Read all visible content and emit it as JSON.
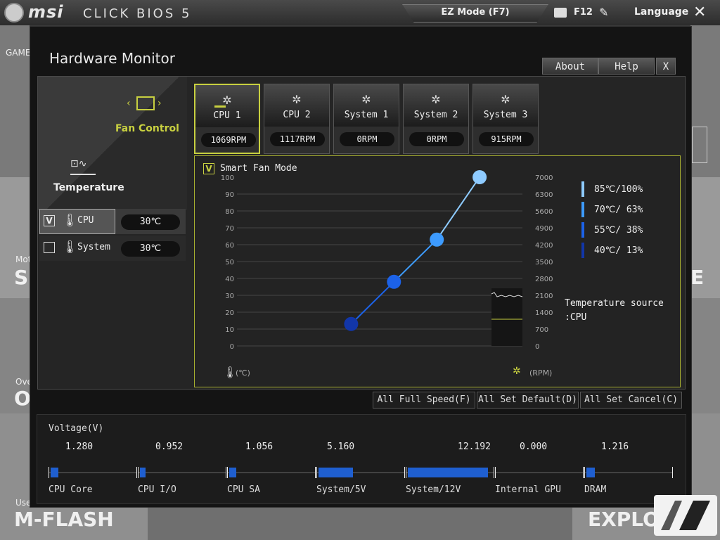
{
  "topbar": {
    "brand": "msi",
    "brand_sub": "CLICK BIOS 5",
    "ez_mode": "EZ Mode (F7)",
    "screenshot_key": "F12",
    "language": "Language",
    "close": "✕"
  },
  "background": {
    "tile_left_top_small": "GAME",
    "tile_left_1_small": "Mot",
    "tile_left_1_big": "SI",
    "tile_left_2_small": "Ove",
    "tile_left_2_big": "O",
    "tile_left_3_small": "Use",
    "tile_left_3_big": "M-FLASH",
    "tile_right_1_big": "E",
    "tile_right_3_big": "EXPLO"
  },
  "modal": {
    "title": "Hardware Monitor",
    "about": "About",
    "help": "Help",
    "close": "X"
  },
  "leftnav": {
    "fan_control": "Fan Control",
    "temperature": "Temperature",
    "sensors": [
      {
        "name": "CPU",
        "value": "30℃",
        "checked": "V"
      },
      {
        "name": "System",
        "value": "30℃",
        "checked": ""
      }
    ]
  },
  "fans": [
    {
      "name": "CPU 1",
      "rpm": "1069RPM"
    },
    {
      "name": "CPU 2",
      "rpm": "1117RPM"
    },
    {
      "name": "System 1",
      "rpm": "0RPM"
    },
    {
      "name": "System 2",
      "rpm": "0RPM"
    },
    {
      "name": "System 3",
      "rpm": "915RPM"
    }
  ],
  "graph": {
    "smart_check": "V",
    "smart_label": "Smart Fan Mode",
    "temp_unit": "(℃)",
    "rpm_unit": "(RPM)",
    "temp_source_line1": "Temperature source",
    "temp_source_line2": ":CPU",
    "legend": [
      {
        "label": "85℃/100%",
        "color": "#8ecbff"
      },
      {
        "label": "70℃/ 63%",
        "color": "#3d9bff"
      },
      {
        "label": "55℃/ 38%",
        "color": "#1c62e8"
      },
      {
        "label": "40℃/ 13%",
        "color": "#1236a8"
      }
    ]
  },
  "chart_data": {
    "type": "line",
    "left_ticks": [
      "100",
      "90",
      "80",
      "70",
      "60",
      "50",
      "40",
      "30",
      "20",
      "10",
      "0"
    ],
    "right_ticks": [
      "7000",
      "6300",
      "5600",
      "4900",
      "4200",
      "3500",
      "2800",
      "2100",
      "1400",
      "700",
      "0"
    ],
    "ylim": [
      0,
      100
    ],
    "series": [
      {
        "points": [
          [
            40,
            13
          ],
          [
            55,
            38
          ],
          [
            70,
            63
          ],
          [
            85,
            100
          ]
        ]
      }
    ],
    "x": [
      40,
      55,
      70,
      85
    ],
    "y": [
      13,
      38,
      63,
      100
    ],
    "point_colors": [
      "#1236a8",
      "#1c62e8",
      "#3d9bff",
      "#8ecbff"
    ]
  },
  "buttons": {
    "full_speed": "All Full Speed(F)",
    "set_default": "All Set Default(D)",
    "set_cancel": "All Set Cancel(C)"
  },
  "voltage": {
    "title": "Voltage(V)",
    "items": [
      {
        "label": "CPU Core",
        "value": "1.280",
        "fill": 0.09
      },
      {
        "label": "CPU I/O",
        "value": "0.952",
        "fill": 0.07
      },
      {
        "label": "CPU SA",
        "value": "1.056",
        "fill": 0.08
      },
      {
        "label": "System/5V",
        "value": "5.160",
        "fill": 0.41
      },
      {
        "label": "System/12V",
        "value": "12.192",
        "fill": 0.95
      },
      {
        "label": "Internal GPU",
        "value": "0.000",
        "fill": 0.0
      },
      {
        "label": "DRAM",
        "value": "1.216",
        "fill": 0.1
      }
    ]
  }
}
